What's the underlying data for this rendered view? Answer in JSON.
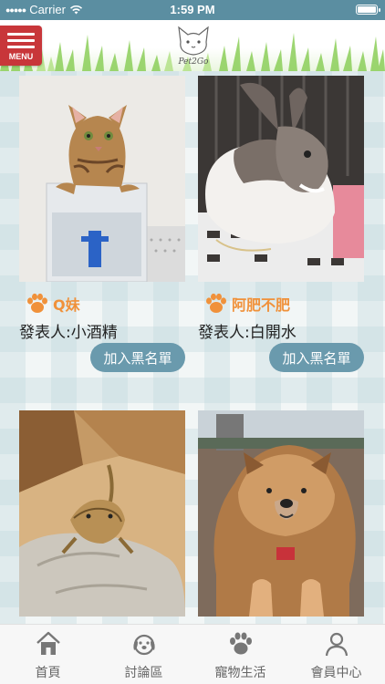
{
  "status_bar": {
    "carrier": "Carrier",
    "time": "1:59 PM"
  },
  "header": {
    "menu_label": "MENU",
    "logo_text": "Pet2Go"
  },
  "posts": [
    {
      "pet_name": "Q妹",
      "poster": "發表人:小酒精",
      "button": "加入黑名單",
      "photo_subject": "cat-on-water-dispenser"
    },
    {
      "pet_name": "阿肥不肥",
      "poster": "發表人:白開水",
      "button": "加入黑名單",
      "photo_subject": "rabbit"
    },
    {
      "photo_subject": "bearded-dragon-on-rock"
    },
    {
      "photo_subject": "chow-chow-dog"
    }
  ],
  "tabs": [
    {
      "label": "首頁",
      "icon": "home-icon"
    },
    {
      "label": "討論區",
      "icon": "dog-face-icon"
    },
    {
      "label": "寵物生活",
      "icon": "paw-icon"
    },
    {
      "label": "會員中心",
      "icon": "user-icon"
    }
  ],
  "colors": {
    "status_bar": "#5b8ea1",
    "menu_button": "#c8363a",
    "pet_name": "#f0913a",
    "blacklist_button": "#6a9aad"
  }
}
